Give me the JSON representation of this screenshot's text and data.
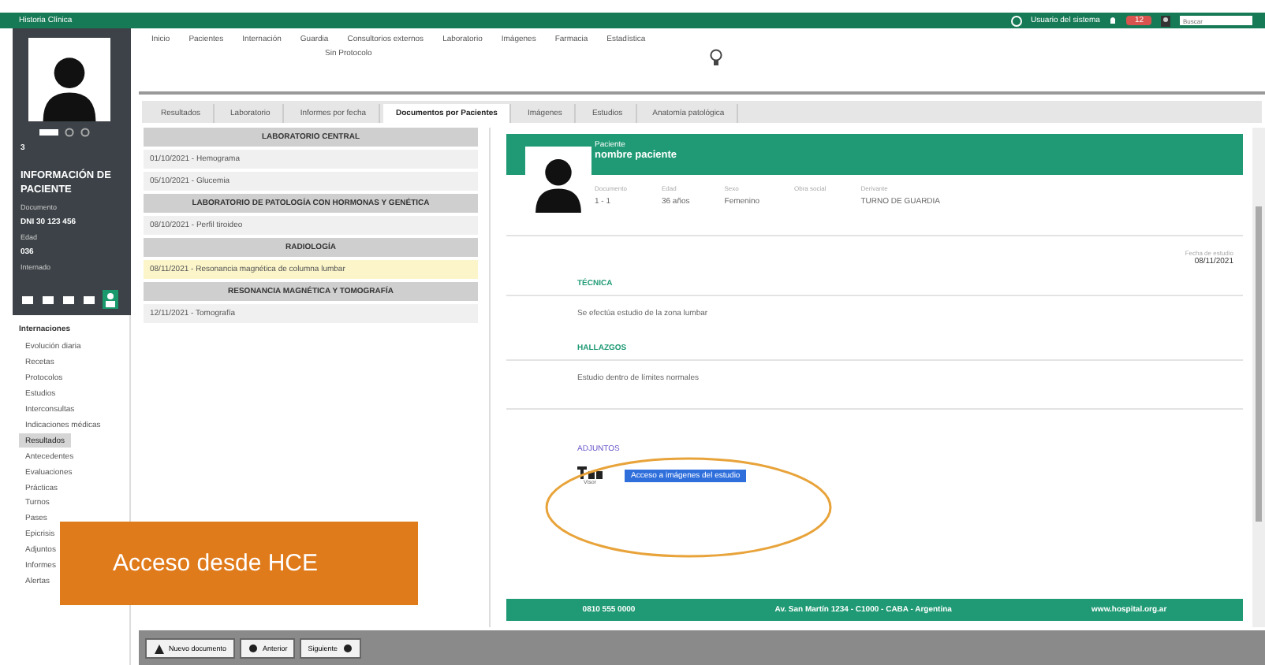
{
  "app_title": "Historia Clínica",
  "header": {
    "user": "Usuario del sistema",
    "alert_badge": "12",
    "search": {
      "placeholder": "Buscar"
    }
  },
  "sidebar": {
    "title": "INFORMACIÓN DE PACIENTE",
    "number": "3",
    "id_label": "Documento",
    "id_value": "DNI 30 123 456",
    "age_label": "Edad",
    "age_value": "036",
    "status": "Internado",
    "menu_title": "Internaciones",
    "items": [
      {
        "label": "Evolución diaria",
        "selected": false
      },
      {
        "label": "Recetas",
        "selected": false
      },
      {
        "label": "Protocolos",
        "selected": false
      },
      {
        "label": "Estudios",
        "selected": false
      },
      {
        "label": "Interconsultas",
        "selected": false
      },
      {
        "label": "Indicaciones médicas",
        "selected": false
      },
      {
        "label": "Resultados",
        "selected": true
      },
      {
        "label": "Antecedentes",
        "selected": false
      },
      {
        "label": "Evaluaciones",
        "selected": false
      },
      {
        "label": "Prácticas",
        "selected": false
      },
      {
        "label": "Turnos",
        "selected": false
      },
      {
        "label": "Pases",
        "selected": false
      },
      {
        "label": "Epicrisis",
        "selected": false
      },
      {
        "label": "Adjuntos",
        "selected": false
      },
      {
        "label": "Informes",
        "selected": false
      },
      {
        "label": "Alertas",
        "selected": false
      }
    ]
  },
  "toolbar": {
    "items": [
      "Inicio",
      "Pacientes",
      "Internación",
      "Guardia",
      "Consultorios externos",
      "Laboratorio",
      "Imágenes",
      "Farmacia",
      "Estadística"
    ],
    "protocol_label": "Sin Protocolo"
  },
  "tabs": [
    {
      "label": "Resultados",
      "selected": false
    },
    {
      "label": "Laboratorio",
      "selected": false
    },
    {
      "label": "Informes por fecha",
      "selected": false
    },
    {
      "label": "Documentos por Pacientes",
      "selected": true
    },
    {
      "label": "Imágenes",
      "selected": false
    },
    {
      "label": "Estudios",
      "selected": false
    },
    {
      "label": "Anatomía patológica",
      "selected": false
    }
  ],
  "left_panel": [
    {
      "title": "LABORATORIO CENTRAL",
      "rows": [
        {
          "text": "01/10/2021 - Hemograma",
          "highlighted": false
        },
        {
          "text": "05/10/2021 - Glucemia",
          "highlighted": false
        }
      ]
    },
    {
      "title": "LABORATORIO DE PATOLOGÍA CON HORMONAS Y GENÉTICA",
      "rows": [
        {
          "text": "08/10/2021 - Perfil tiroideo",
          "highlighted": false
        }
      ]
    },
    {
      "title": "RADIOLOGÍA",
      "rows": [
        {
          "text": "08/11/2021 - Resonancia magnética de columna lumbar",
          "highlighted": true
        }
      ]
    },
    {
      "title": "RESONANCIA MAGNÉTICA Y TOMOGRAFÍA",
      "rows": [
        {
          "text": "12/11/2021 - Tomografía",
          "highlighted": false
        }
      ]
    }
  ],
  "report": {
    "label": "Paciente",
    "name": "nombre paciente",
    "fields": [
      {
        "label": "Documento",
        "value": "1 - 1"
      },
      {
        "label": "Edad",
        "value": "36 años"
      },
      {
        "label": "Sexo",
        "value": "Femenino"
      },
      {
        "label": "Obra social"
      },
      {
        "label": "Derivante",
        "value": "TURNO DE GUARDIA"
      }
    ],
    "date_label": "Fecha de estudio",
    "date": "08/11/2021",
    "sections": [
      {
        "title": "TÉCNICA",
        "text": "Se efectúa estudio de la zona lumbar"
      },
      {
        "title": "HALLAZGOS",
        "text": "Estudio dentro de límites normales"
      }
    ],
    "attachments_title": "ADJUNTOS",
    "attachment_caption": "Visor",
    "attachment_link": "Acceso a imágenes del estudio",
    "footer": [
      "0810 555 0000",
      "Av. San Martín 1234 - C1000 - CABA - Argentina",
      "www.hospital.org.ar"
    ]
  },
  "bottom_buttons": [
    "Nuevo documento",
    "Anterior",
    "Siguiente"
  ],
  "overlay_caption": "Acceso desde HCE"
}
